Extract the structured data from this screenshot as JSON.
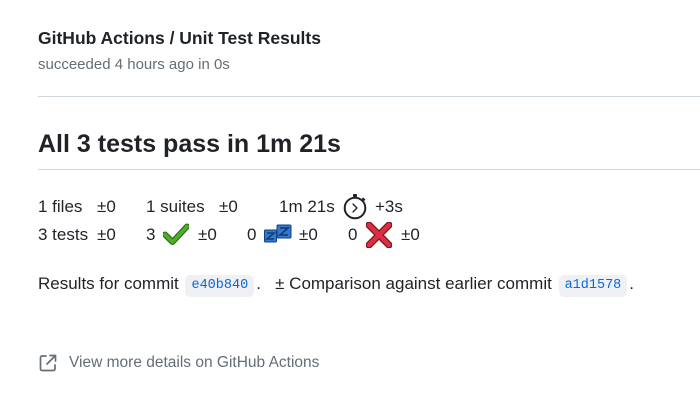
{
  "header": {
    "title": "GitHub Actions / Unit Test Results",
    "subtitle": "succeeded 4 hours ago in 0s"
  },
  "summary": {
    "heading": "All 3 tests pass in 1m 21s"
  },
  "stats": {
    "files_text": "1 files",
    "files_delta": "±0",
    "suites_text": "1 suites",
    "suites_delta": "±0",
    "duration_text": "1m 21s",
    "duration_delta": "+3s",
    "tests_text": "3 tests",
    "tests_delta": "±0",
    "passed_count": "3",
    "passed_delta": "±0",
    "skipped_count": "0",
    "skipped_delta": "±0",
    "failed_count": "0",
    "failed_delta": "±0"
  },
  "icons": {
    "duration": "stopwatch-icon",
    "passed": "check-mark-icon",
    "skipped": "sleeping-zzz-icon",
    "failed": "cross-mark-icon",
    "external_link": "external-link-icon"
  },
  "commit": {
    "prefix": "Results for commit",
    "sha": "e40b840",
    "sep": ".",
    "comparison_text": "± Comparison against earlier commit",
    "earlier_sha": "a1d1578",
    "suffix": "."
  },
  "footer": {
    "details_link": "View more details on GitHub Actions"
  },
  "colors": {
    "text": "#1f2328",
    "muted": "#656d76",
    "link": "#0969da",
    "pass_green": "#4caf2a",
    "fail_red": "#dd2e44",
    "skip_blue": "#2e7bd6"
  }
}
